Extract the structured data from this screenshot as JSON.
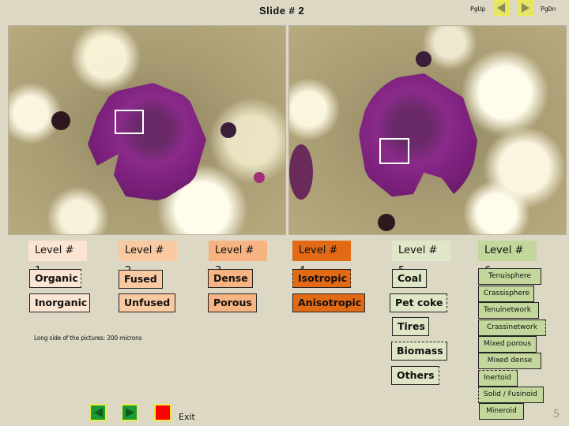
{
  "header": {
    "title": "Slide  # 2",
    "pgup_label": "PgUp",
    "pgdn_label": "PgDn",
    "pgup_icon": "triangle-left-icon",
    "pgdn_icon": "triangle-right-icon"
  },
  "photos": [
    {
      "name": "left-micrograph",
      "roi": "upper-left region of particle"
    },
    {
      "name": "right-micrograph",
      "roi": "lower-left region of particle"
    }
  ],
  "levels": [
    {
      "label": "Level # 1",
      "color": "#fbe4d2",
      "options": [
        "Organic",
        "Inorganic"
      ],
      "option_color": "#fbe4d2"
    },
    {
      "label": "Level # 2",
      "color": "#f9c9a2",
      "options": [
        "Fused",
        "Unfused"
      ],
      "option_color": "#f9c9a2"
    },
    {
      "label": "Level # 3",
      "color": "#f7b381",
      "options": [
        "Dense",
        "Porous"
      ],
      "option_color": "#f7b381"
    },
    {
      "label": "Level # 4",
      "color": "#e26a14",
      "options": [
        "Isotropic",
        "Anisotropic"
      ],
      "option_color": "#e26a14"
    },
    {
      "label": "Level # 5",
      "color": "#e0e7c8",
      "options": [
        "Coal",
        "Pet coke",
        "Tires",
        "Biomass",
        "Others"
      ],
      "option_color": "#dfe6c5"
    },
    {
      "label": "Level # 6",
      "color": "#c3d69b",
      "options": [
        "Tenuisphere",
        "Crassisphere",
        "Tenuinetwork",
        "Crassinetwork",
        "Mixed porous",
        "Mixed dense",
        "Inertoid",
        "Solid / Fusinoid",
        "Mineroid"
      ],
      "option_color": "#c3d69b"
    }
  ],
  "note": "Long side of the pictures: 200 microns",
  "footer": {
    "prev_icon": "triangle-left-icon",
    "next_icon": "triangle-right-icon",
    "exit_icon": "red-square-icon",
    "exit_label": "Exit",
    "page_number": "5"
  }
}
